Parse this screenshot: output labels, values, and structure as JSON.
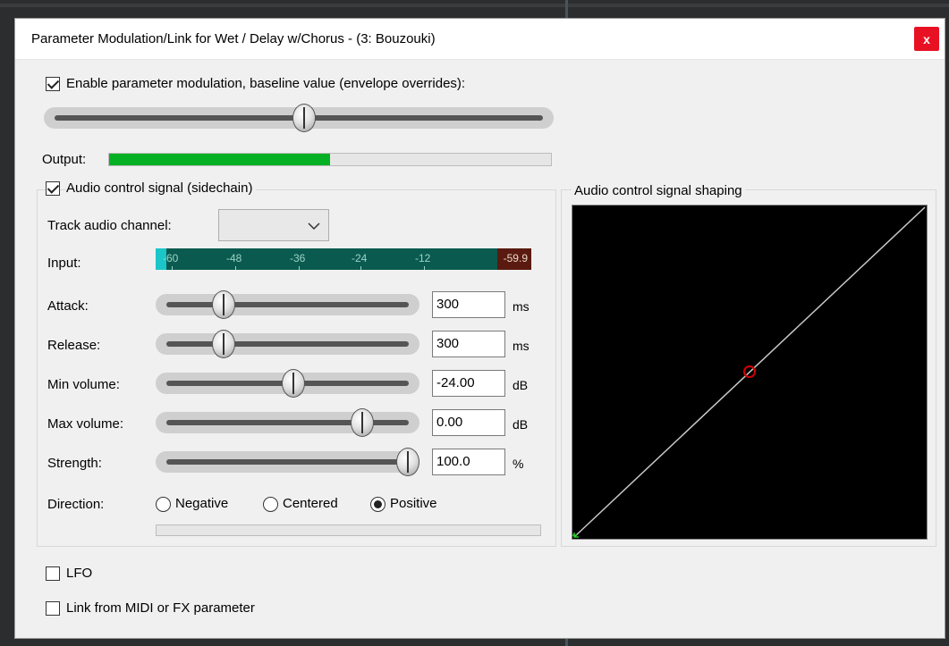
{
  "window": {
    "title": "Parameter Modulation/Link for Wet / Delay w/Chorus - (3: Bouzouki)",
    "close_glyph": "x"
  },
  "baseline": {
    "enable_label": "Enable parameter modulation, baseline value (envelope overrides):",
    "enabled": true,
    "slider_value": 0.5
  },
  "output": {
    "label": "Output:",
    "level": 0.5
  },
  "audio_control": {
    "group_label": "Audio control signal (sidechain)",
    "enabled": true,
    "track_channel_label": "Track audio channel:",
    "track_channel_value": "",
    "input_label": "Input:",
    "meter_ticks": [
      "-60",
      "-48",
      "-36",
      "-24",
      "-12"
    ],
    "meter_peak": "-59.9",
    "params": [
      {
        "label": "Attack:",
        "value": "300",
        "unit": "ms",
        "slider": 0.2
      },
      {
        "label": "Release:",
        "value": "300",
        "unit": "ms",
        "slider": 0.2
      },
      {
        "label": "Min volume:",
        "value": "-24.00",
        "unit": "dB",
        "slider": 0.5
      },
      {
        "label": "Max volume:",
        "value": "0.00",
        "unit": "dB",
        "slider": 0.8
      },
      {
        "label": "Strength:",
        "value": "100.0",
        "unit": "%",
        "slider": 1.0
      }
    ],
    "direction_label": "Direction:",
    "directions": [
      {
        "label": "Negative",
        "selected": false
      },
      {
        "label": "Centered",
        "selected": false
      },
      {
        "label": "Positive",
        "selected": true
      }
    ]
  },
  "shaping": {
    "label": "Audio control signal shaping",
    "curve_color": "#c8c8c8",
    "point_color": "#d00000",
    "corner_color": "#22cc22"
  },
  "lfo": {
    "label": "LFO",
    "enabled": false
  },
  "link": {
    "label": "Link from MIDI or FX parameter",
    "enabled": false
  },
  "colors": {
    "progress": "#06b025",
    "meter_bg": "#0b5a4f",
    "meter_clip": "#5a1a10"
  }
}
